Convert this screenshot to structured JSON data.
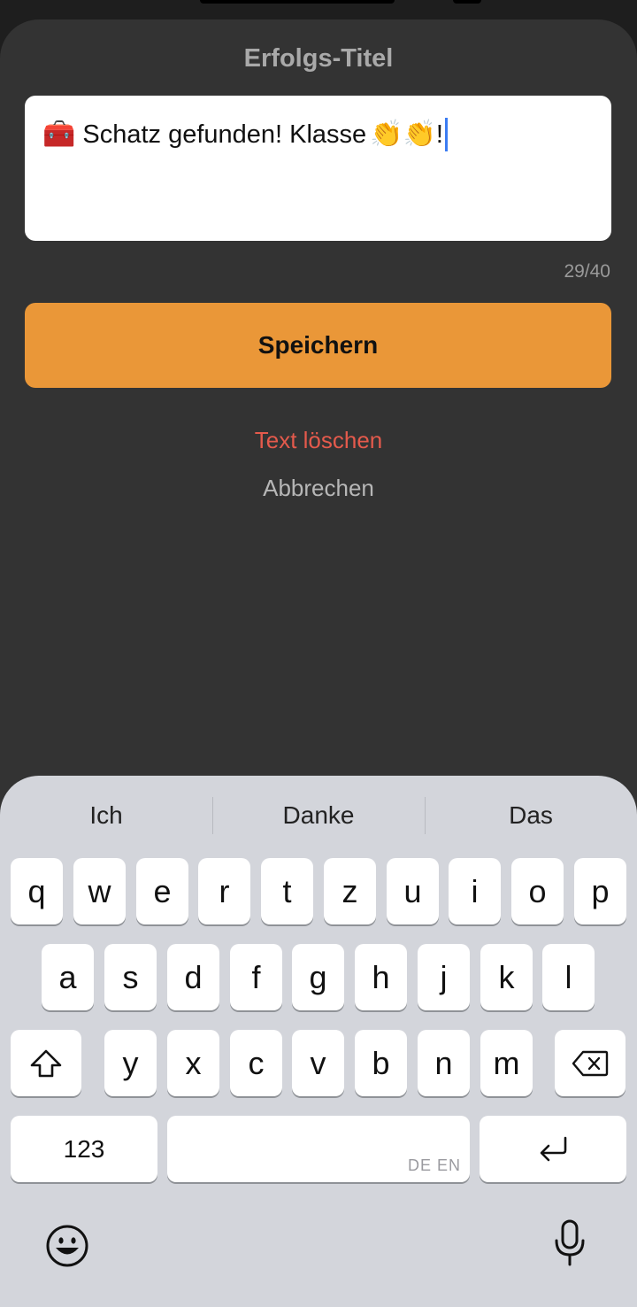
{
  "dialog": {
    "title": "Erfolgs-Titel",
    "text_value": "Schatz gefunden! Klasse",
    "text_suffix": "!",
    "leading_emoji": "🧰",
    "trailing_emoji_1": "👏",
    "trailing_emoji_2": "👏",
    "char_counter": "29/40",
    "save_label": "Speichern",
    "clear_label": "Text löschen",
    "cancel_label": "Abbrechen"
  },
  "keyboard": {
    "suggestions": [
      "Ich",
      "Danke",
      "Das"
    ],
    "row1": [
      "q",
      "w",
      "e",
      "r",
      "t",
      "z",
      "u",
      "i",
      "o",
      "p"
    ],
    "row2": [
      "a",
      "s",
      "d",
      "f",
      "g",
      "h",
      "j",
      "k",
      "l"
    ],
    "row3": [
      "y",
      "x",
      "c",
      "v",
      "b",
      "n",
      "m"
    ],
    "numbers_label": "123",
    "space_languages": "DE EN",
    "icons": {
      "shift": "shift-icon",
      "backspace": "backspace-icon",
      "return": "return-icon",
      "emoji": "emoji-icon",
      "microphone": "microphone-icon"
    }
  },
  "colors": {
    "sheet_background": "#333333",
    "save_button": "#ea9738",
    "clear_link": "#e45a4c",
    "caret": "#3b7cf2"
  }
}
